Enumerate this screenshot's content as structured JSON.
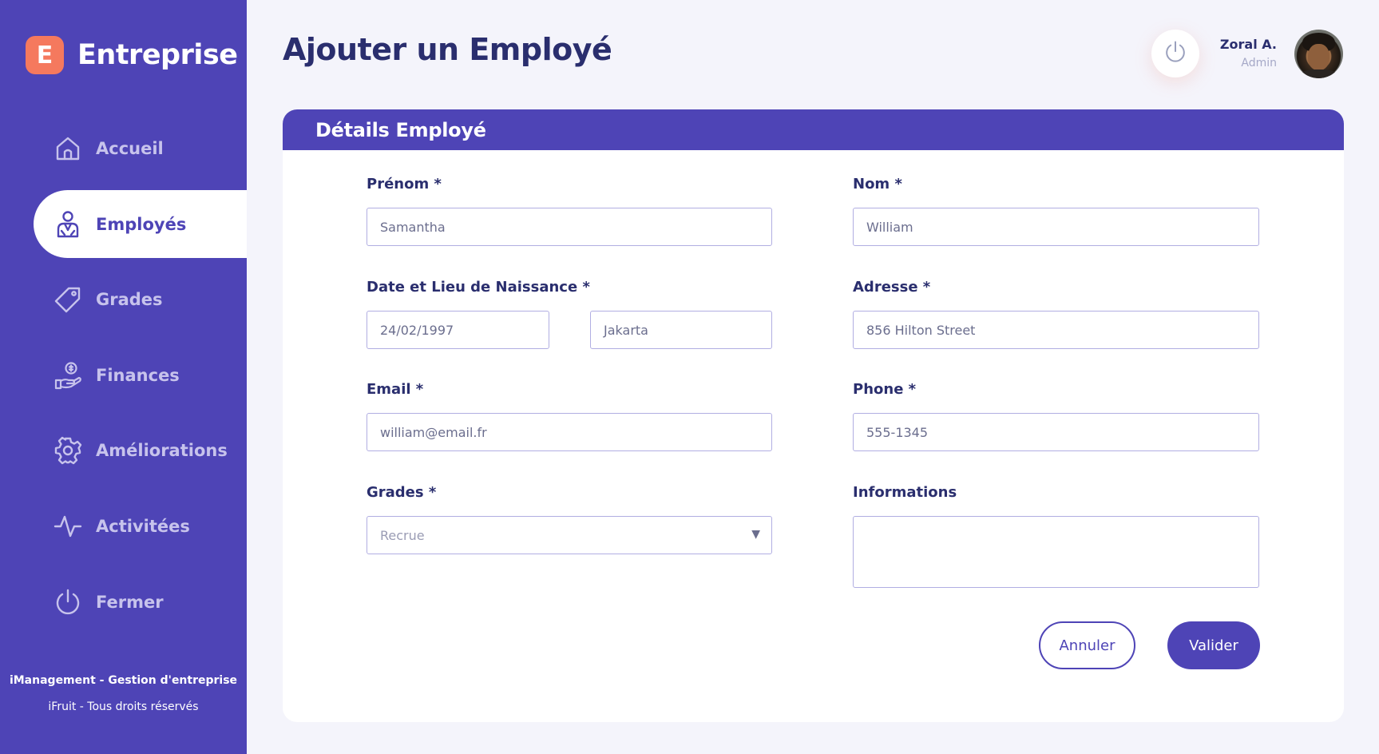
{
  "brand": {
    "logo_letter": "E",
    "name": "Entreprise"
  },
  "sidebar": {
    "items": [
      {
        "label": "Accueil",
        "icon": "home-icon",
        "active": false
      },
      {
        "label": "Employés",
        "icon": "user-icon",
        "active": true
      },
      {
        "label": "Grades",
        "icon": "tag-icon",
        "active": false
      },
      {
        "label": "Finances",
        "icon": "hand-coin-icon",
        "active": false
      },
      {
        "label": "Améliorations",
        "icon": "gear-icon",
        "active": false
      },
      {
        "label": "Activitées",
        "icon": "activity-icon",
        "active": false
      },
      {
        "label": "Fermer",
        "icon": "power-icon",
        "active": false
      }
    ],
    "footer": {
      "line1": "iManagement - Gestion d'entreprise",
      "line2": "iFruit - Tous droits réservés"
    }
  },
  "header": {
    "title": "Ajouter un Employé",
    "user": {
      "name": "Zoral A.",
      "role": "Admin"
    }
  },
  "form": {
    "title": "Détails Employé",
    "fields": {
      "prenom": {
        "label": "Prénom *",
        "value": "Samantha"
      },
      "nom": {
        "label": "Nom *",
        "value": "William"
      },
      "naissance": {
        "label": "Date et Lieu de Naissance *",
        "date": "24/02/1997",
        "lieu": "Jakarta"
      },
      "adresse": {
        "label": "Adresse *",
        "value": "856 Hilton Street"
      },
      "email": {
        "label": "Email *",
        "value": "william@email.fr"
      },
      "phone": {
        "label": "Phone *",
        "value": "555-1345"
      },
      "grades": {
        "label": "Grades *",
        "value": "Recrue"
      },
      "informations": {
        "label": "Informations",
        "value": ""
      }
    },
    "buttons": {
      "cancel": "Annuler",
      "submit": "Valider"
    }
  },
  "colors": {
    "primary": "#4e44b6",
    "accent": "#f5795e",
    "text_dark": "#2a2e6e",
    "sidebar_text": "#c7c3ec",
    "field_border": "#b1aee2",
    "background": "#f4f4fb"
  }
}
